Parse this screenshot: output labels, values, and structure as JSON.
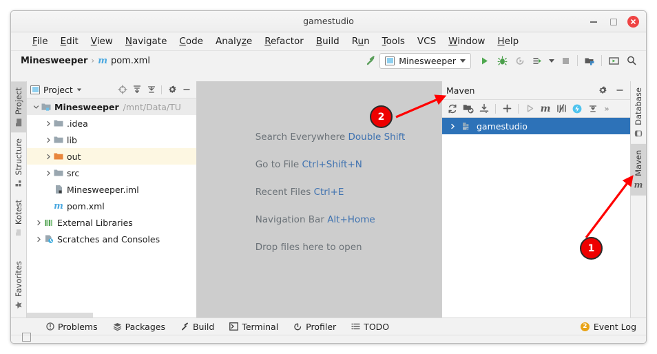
{
  "window": {
    "title": "gamestudio",
    "buttons": {
      "minimize": "minimize",
      "maximize": "maximize",
      "close": "close"
    }
  },
  "menubar": {
    "items": [
      {
        "label": "File",
        "mnemonic_index": 0
      },
      {
        "label": "Edit",
        "mnemonic_index": 0
      },
      {
        "label": "View",
        "mnemonic_index": 0
      },
      {
        "label": "Navigate",
        "mnemonic_index": 0
      },
      {
        "label": "Code",
        "mnemonic_index": 0
      },
      {
        "label": "Analyze",
        "mnemonic_index": 4
      },
      {
        "label": "Refactor",
        "mnemonic_index": 0
      },
      {
        "label": "Build",
        "mnemonic_index": 0
      },
      {
        "label": "Run",
        "mnemonic_index": 1
      },
      {
        "label": "Tools",
        "mnemonic_index": 0
      },
      {
        "label": "VCS",
        "mnemonic_index": -1
      },
      {
        "label": "Window",
        "mnemonic_index": 0
      },
      {
        "label": "Help",
        "mnemonic_index": 0
      }
    ]
  },
  "navbar": {
    "breadcrumb": {
      "project": "Minesweeper",
      "separator": "›",
      "file": "pom.xml",
      "file_icon": "maven-m-icon"
    },
    "toolbar": {
      "build_label": "Build",
      "run_config": {
        "name": "Minesweeper",
        "icon": "application-config-icon"
      },
      "run_label": "Run",
      "debug_label": "Debug",
      "run_coverage_label": "Run with Coverage",
      "profile_label": "Profile",
      "stop_label": "Stop",
      "settings_label": "Settings",
      "updates_label": "Updates",
      "search_label": "Search"
    }
  },
  "left_tool_tabs": [
    {
      "label": "Project",
      "icon": "folder-icon",
      "active": true
    },
    {
      "label": "Structure",
      "icon": "structure-icon",
      "active": false
    },
    {
      "label": "Kotest",
      "icon": "kotest-icon",
      "active": false
    },
    {
      "label": "Favorites",
      "icon": "star-icon",
      "active": false
    }
  ],
  "right_tool_tabs": [
    {
      "label": "Database",
      "icon": "database-icon",
      "active": false
    },
    {
      "label": "Maven",
      "icon": "maven-m-icon",
      "active": true
    }
  ],
  "project_panel": {
    "title": "Project",
    "title_icon": "project-view-icon",
    "buttons": [
      {
        "name": "scroll-from-source",
        "label": "Select Opened File"
      },
      {
        "name": "expand-all",
        "label": "Expand All"
      },
      {
        "name": "collapse-all",
        "label": "Collapse All"
      },
      {
        "name": "settings",
        "label": "Options"
      },
      {
        "name": "hide",
        "label": "Hide"
      }
    ],
    "tree": [
      {
        "label": "Minesweeper",
        "path": "/mnt/Data/TU",
        "icon": "module-icon",
        "expanded": true,
        "depth": 0,
        "bold": true,
        "selected_row": true
      },
      {
        "label": ".idea",
        "icon": "folder-icon",
        "expanded": false,
        "depth": 1
      },
      {
        "label": "lib",
        "icon": "folder-icon",
        "expanded": false,
        "depth": 1
      },
      {
        "label": "out",
        "icon": "folder-orange-icon",
        "expanded": false,
        "depth": 1,
        "highlight": true
      },
      {
        "label": "src",
        "icon": "folder-icon",
        "expanded": false,
        "depth": 1
      },
      {
        "label": "Minesweeper.iml",
        "icon": "iml-file-icon",
        "depth": 1
      },
      {
        "label": "pom.xml",
        "icon": "maven-m-icon",
        "depth": 1
      },
      {
        "label": "External Libraries",
        "icon": "libraries-icon",
        "expanded": false,
        "depth": 0
      },
      {
        "label": "Scratches and Consoles",
        "icon": "scratches-icon",
        "expanded": false,
        "depth": 0
      }
    ]
  },
  "editor": {
    "hints": [
      {
        "action": "Search Everywhere",
        "shortcut": "Double Shift"
      },
      {
        "action": "Go to File",
        "shortcut": "Ctrl+Shift+N"
      },
      {
        "action": "Recent Files",
        "shortcut": "Ctrl+E"
      },
      {
        "action": "Navigation Bar",
        "shortcut": "Alt+Home"
      },
      {
        "action": "Drop files here to open",
        "shortcut": ""
      }
    ]
  },
  "maven_panel": {
    "title": "Maven",
    "header_buttons": [
      {
        "name": "settings",
        "label": "Maven Settings"
      },
      {
        "name": "hide",
        "label": "Hide"
      }
    ],
    "toolbar": [
      {
        "name": "reload-all-maven-projects",
        "label": "Reload All Maven Projects"
      },
      {
        "name": "add-maven-project",
        "label": "Add Maven Project"
      },
      {
        "name": "download-sources",
        "label": "Download Sources and/or Documentation"
      },
      {
        "name": "add-plugin",
        "label": "Add"
      },
      {
        "name": "execute-goal",
        "label": "Run Maven Build"
      },
      {
        "name": "run-maven-goal",
        "label": "Execute Maven Goal"
      },
      {
        "name": "toggle-skip-tests",
        "label": "Toggle Skip Tests Mode"
      },
      {
        "name": "toggle-offline-mode",
        "label": "Toggle Offline Mode"
      },
      {
        "name": "collapse-all",
        "label": "Collapse All"
      },
      {
        "name": "more",
        "label": "More"
      }
    ],
    "tree": [
      {
        "label": "gamestudio",
        "icon": "maven-project-icon",
        "expanded": false,
        "selected": true
      }
    ]
  },
  "statusbar": {
    "items": [
      {
        "label": "Problems",
        "icon": "problems-icon"
      },
      {
        "label": "Packages",
        "icon": "packages-icon"
      },
      {
        "label": "Build",
        "icon": "build-icon"
      },
      {
        "label": "Terminal",
        "icon": "terminal-icon"
      },
      {
        "label": "Profiler",
        "icon": "profiler-icon"
      },
      {
        "label": "TODO",
        "icon": "todo-icon"
      }
    ],
    "event_log": {
      "label": "Event Log",
      "count": "2"
    }
  },
  "annotations": [
    {
      "number": "2",
      "target": "maven-reload-button"
    },
    {
      "number": "1",
      "target": "maven-tool-window-tab"
    }
  ],
  "colors": {
    "accent_blue": "#2d72b8",
    "link_blue": "#3f72b0",
    "marker_red": "#ee0000",
    "badge_orange": "#e8a317",
    "highlight_yellow": "#fdf7e2",
    "folder_orange": "#e8863c",
    "editor_bg": "#cdcdcd"
  }
}
